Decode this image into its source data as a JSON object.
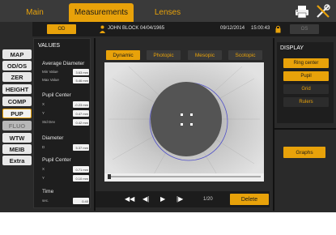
{
  "tabs": {
    "main": "Main",
    "measurements": "Measurements",
    "lenses": "Lenses"
  },
  "header": {
    "od": "OD",
    "patient": "JOHN  BLOCK  04/04/1965",
    "date": "09/12/2014",
    "time": "15:00:43",
    "os": "OS"
  },
  "sidebar": {
    "items": [
      {
        "label": "MAP"
      },
      {
        "label": "OD/OS"
      },
      {
        "label": "ZER"
      },
      {
        "label": "HEIGHT"
      },
      {
        "label": "COMP"
      },
      {
        "label": "PUP"
      },
      {
        "label": "FLUO"
      },
      {
        "label": "WTW"
      },
      {
        "label": "MEIB"
      },
      {
        "label": "Extra"
      }
    ]
  },
  "values": {
    "title": "VALUES",
    "avg_diam": {
      "label": "Average Diameter",
      "min_label": "Min Value",
      "min": "3.63 mm",
      "max_label": "Max Value",
      "max": "5.46 mm"
    },
    "pupil_center": {
      "label": "Pupil Center",
      "x_label": "X",
      "x": "-0.23 mm",
      "y_label": "Y",
      "y": "0.47 mm",
      "std_label": "Std Dev",
      "std": "0.42 mm"
    },
    "diameter": {
      "label": "Diameter",
      "d_label": "D",
      "d": "5.37 mm"
    },
    "pupil_center2": {
      "label": "Pupil Center",
      "x_label": "X",
      "x": "0.71 mm",
      "y_label": "Y",
      "y": "0.10 mm"
    },
    "time": {
      "label": "Time",
      "sec_label": "sec.",
      "sec": "0.40"
    }
  },
  "modes": {
    "dynamic": "Dynamic",
    "photopic": "Photopic",
    "mesopic": "Mesopic",
    "scotopic": "Scotopic"
  },
  "playback": {
    "frame": "1/20",
    "delete": "Delete",
    "progress_fraction": 0.02
  },
  "display": {
    "title": "DISPLAY",
    "ring": "Ring center",
    "pupil": "Pupil",
    "grid": "Grid",
    "rulers": "Rulers",
    "graphs": "Graphs"
  },
  "icons": {
    "printer": "printer-icon",
    "tools": "tools-icon",
    "patient": "person-icon",
    "lock": "lock-icon"
  },
  "colors": {
    "accent": "#e8a20a",
    "panel": "#1e1e1e",
    "background": "#2a2a2a"
  }
}
